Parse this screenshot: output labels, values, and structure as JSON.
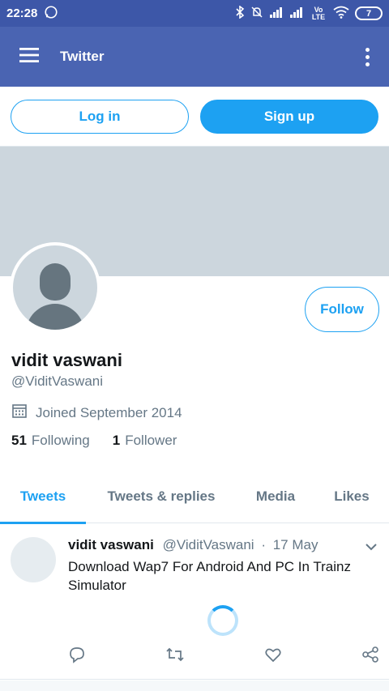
{
  "status_bar": {
    "time": "22:28",
    "network": "Vo LTE",
    "battery": "7"
  },
  "app_bar": {
    "title": "Twitter"
  },
  "auth": {
    "login_label": "Log in",
    "signup_label": "Sign up"
  },
  "profile": {
    "name": "vidit vaswani",
    "handle": "@ViditVaswani",
    "joined": "Joined September 2014",
    "following_count": "51",
    "following_label": "Following",
    "followers_count": "1",
    "followers_label": "Follower",
    "follow_label": "Follow"
  },
  "tabs": [
    {
      "label": "Tweets"
    },
    {
      "label": "Tweets & replies"
    },
    {
      "label": "Media"
    },
    {
      "label": "Likes"
    }
  ],
  "tweet": {
    "name": "vidit vaswani",
    "handle": "@ViditVaswani",
    "separator": "·",
    "date": "17 May",
    "text": "Download Wap7 For Android And PC In Trainz Simulator"
  },
  "colors": {
    "accent": "#1da1f2",
    "app_bar": "#4a64b2",
    "status_bar": "#3d57a8",
    "banner": "#ccd6dd"
  }
}
